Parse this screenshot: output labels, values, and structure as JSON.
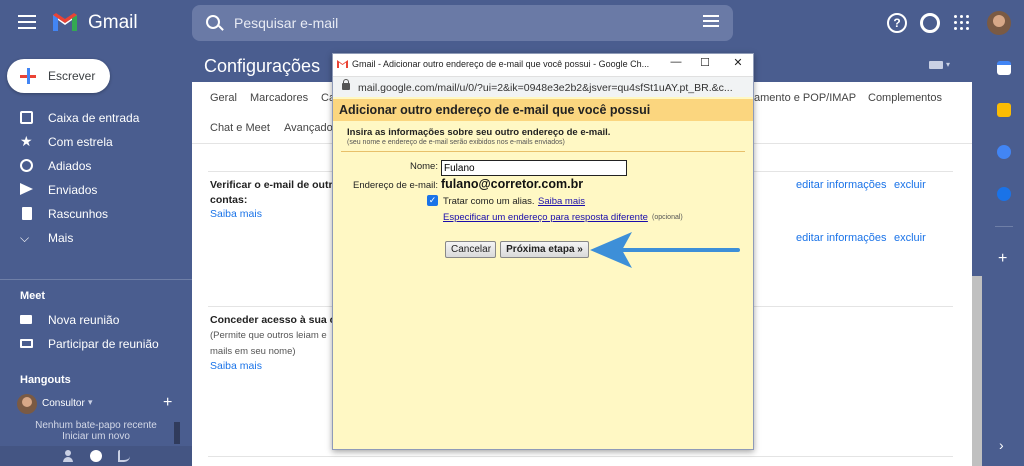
{
  "app": {
    "name": "Gmail",
    "search_placeholder": "Pesquisar e-mail"
  },
  "sidebar": {
    "compose_label": "Escrever",
    "items": [
      {
        "label": "Caixa de entrada",
        "icon": "inbox-icon"
      },
      {
        "label": "Com estrela",
        "icon": "star-icon"
      },
      {
        "label": "Adiados",
        "icon": "clock-icon"
      },
      {
        "label": "Enviados",
        "icon": "send-icon"
      },
      {
        "label": "Rascunhos",
        "icon": "draft-icon"
      },
      {
        "label": "Mais",
        "icon": "chevron-down-icon"
      }
    ],
    "meet": {
      "title": "Meet",
      "new_meeting": "Nova reunião",
      "join_meeting": "Participar de reunião"
    },
    "hangouts": {
      "title": "Hangouts",
      "user": "Consultor",
      "no_chats": "Nenhum bate-papo recente",
      "start_new": "Iniciar um novo"
    }
  },
  "settings": {
    "title": "Configurações",
    "tabs": [
      "Geral",
      "Marcadores",
      "Ca",
      "amento e POP/IMAP",
      "Complementos",
      "Chat e Meet",
      "Avançado"
    ],
    "verify_title_1": "Verificar o e-mail de outr",
    "verify_title_2": "contas:",
    "learn_more_1": "Saiba mais",
    "edit_info": "editar informações",
    "delete": "excluir",
    "grant_title": "Conceder acesso à sua co",
    "grant_desc_1": "(Permite que outros leiam e",
    "grant_desc_2": "mails em seu nome)",
    "learn_more_2": "Saiba mais"
  },
  "popup": {
    "window_title": "Gmail - Adicionar outro endereço de e-mail que você possui - Google Ch...",
    "url": "mail.google.com/mail/u/0/?ui=2&ik=0948e3e2b2&jsver=qu4sfSt1uAY.pt_BR.&c...",
    "header": "Adicionar outro endereço de e-mail que você possui",
    "intro": "Insira as informações sobre seu outro endereço de e-mail.",
    "intro_small": "(seu nome e endereço de e-mail serão exibidos nos e-mails enviados)",
    "name_label": "Nome:",
    "name_value": "Fulano",
    "email_label": "Endereço de e-mail:",
    "email_value": "fulano@corretor.com.br",
    "alias_label": "Tratar como um alias.",
    "alias_link": "Saiba mais",
    "reply_link": "Especificar um endereço para resposta diferente",
    "reply_optional": "(opcional)",
    "cancel": "Cancelar",
    "next": "Próxima etapa »",
    "window_controls": {
      "minimize": "—",
      "maximize": "☐",
      "close": "✕"
    }
  },
  "colors": {
    "theme": "#4a5d8f",
    "popup_body": "#fff8c4",
    "popup_header": "#fbd67f",
    "link": "#1a73e8",
    "arrow": "#3d8fd8"
  }
}
